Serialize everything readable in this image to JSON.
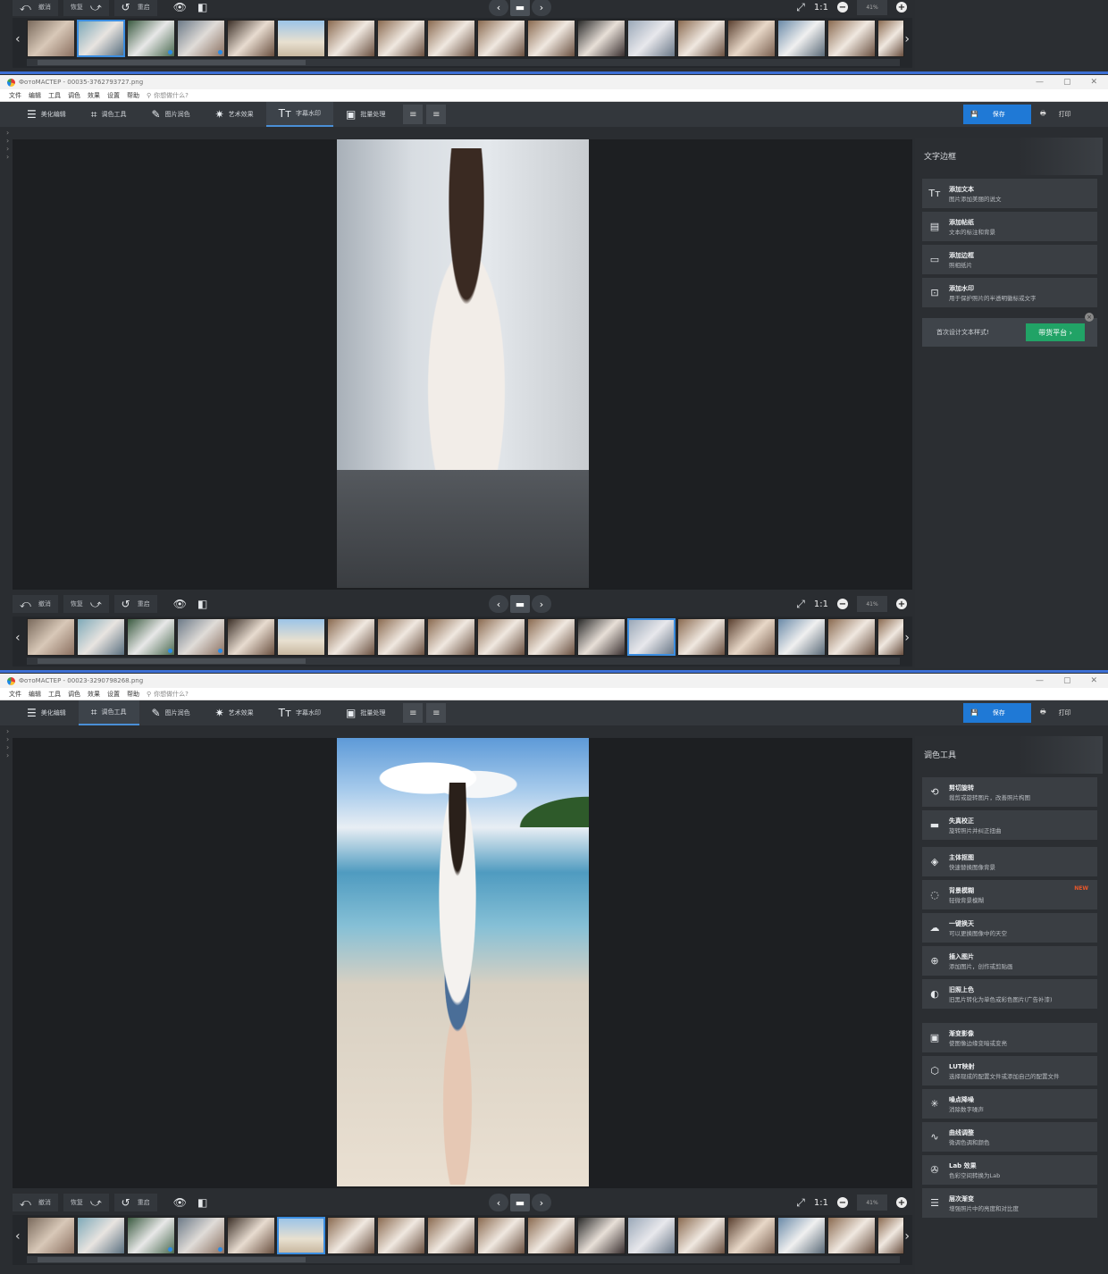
{
  "windows": [
    {
      "title": "ФотоМАСТЕР - 00035-3762793727.png"
    },
    {
      "title": "ФотоМАСТЕР - 00023-3290798268.png"
    }
  ],
  "window_controls": {
    "minimize": "—",
    "maximize": "▢",
    "close": "✕"
  },
  "menu": [
    "文件",
    "编辑",
    "工具",
    "调色",
    "效果",
    "设置",
    "帮助"
  ],
  "search_placeholder": "你想做什么?",
  "tabs": [
    {
      "label": "美化编辑",
      "icon": "sliders-icon"
    },
    {
      "label": "调色工具",
      "icon": "crop-icon"
    },
    {
      "label": "图片润色",
      "icon": "brush-icon"
    },
    {
      "label": "艺术效果",
      "icon": "magic-wand-icon"
    },
    {
      "label": "字幕水印",
      "icon": "text-icon"
    },
    {
      "label": "批量处理",
      "icon": "batch-icon"
    }
  ],
  "save_label": "保存",
  "print_label": "打印",
  "controls": {
    "undo": "撤消",
    "redo": "恢复",
    "reset": "重启",
    "one_to_one": "1:1",
    "zoom": "41%"
  },
  "panel_text": {
    "title": "文字边框",
    "tools": [
      {
        "title": "添加文本",
        "desc": "图片添加美丽的说文",
        "icon": "text-tool-icon"
      },
      {
        "title": "添加帖纸",
        "desc": "文本的标注和背景",
        "icon": "sticker-icon"
      },
      {
        "title": "添加边框",
        "desc": "照相纸片",
        "icon": "frame-icon"
      },
      {
        "title": "添加水印",
        "desc": "用于保护照片的半透明徽标或文字",
        "icon": "watermark-icon"
      }
    ],
    "promo_text": "首次设计文本样式!",
    "promo_button": "带货平台 ›"
  },
  "panel_color": {
    "title": "调色工具",
    "tools": [
      {
        "title": "剪切旋转",
        "desc": "裁剪或旋转图片，改善照片构图",
        "icon": "rotate-crop-icon",
        "new": ""
      },
      {
        "title": "失真校正",
        "desc": "旋转照片并纠正扭曲",
        "icon": "distortion-icon",
        "new": ""
      },
      {
        "title": "主体抠图",
        "desc": "快速替换图像背景",
        "icon": "cutout-icon",
        "new": ""
      },
      {
        "title": "背景模糊",
        "desc": "轻微背景模糊",
        "icon": "blur-icon",
        "new": "NEW"
      },
      {
        "title": "一键换天",
        "desc": "可以更换图像中的天空",
        "icon": "sky-icon",
        "new": ""
      },
      {
        "title": "插入图片",
        "desc": "添加图片，创作或剪贴画",
        "icon": "insert-image-icon",
        "new": ""
      },
      {
        "title": "旧照上色",
        "desc": "旧黑片转化为单色或彩色图片(广告补漆)",
        "icon": "colorize-icon",
        "new": ""
      },
      {
        "title": "渐变影像",
        "desc": "使图像边缘变暗或变亮",
        "icon": "vignette-icon",
        "new": ""
      },
      {
        "title": "LUT映射",
        "desc": "选择现成的配置文件或添加自己的配置文件",
        "icon": "lut-icon",
        "new": ""
      },
      {
        "title": "噪点降噪",
        "desc": "消除数字噪声",
        "icon": "denoise-icon",
        "new": ""
      },
      {
        "title": "曲线调整",
        "desc": "微调色调和颜色",
        "icon": "curve-icon",
        "new": ""
      },
      {
        "title": "Lab 效果",
        "desc": "色彩空间转换为Lab",
        "icon": "lab-icon",
        "new": ""
      },
      {
        "title": "层次渐变",
        "desc": "增强照片中的亮度和对比度",
        "icon": "layers-icon",
        "new": ""
      }
    ]
  },
  "colors": {
    "accent": "#1f79d6",
    "promo_green": "#21a366",
    "new_badge": "#e8572a"
  }
}
